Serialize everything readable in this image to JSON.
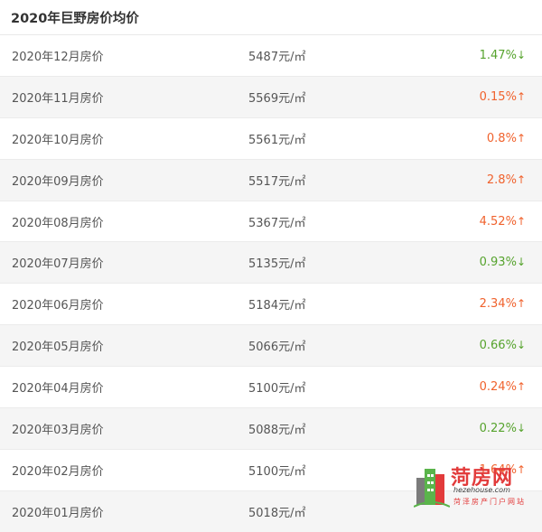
{
  "title": "2020年巨野房价均价",
  "rows": [
    {
      "month": "2020年12月房价",
      "price": "5487元/㎡",
      "change": "1.47%",
      "dir": "down"
    },
    {
      "month": "2020年11月房价",
      "price": "5569元/㎡",
      "change": "0.15%",
      "dir": "up"
    },
    {
      "month": "2020年10月房价",
      "price": "5561元/㎡",
      "change": "0.8%",
      "dir": "up"
    },
    {
      "month": "2020年09月房价",
      "price": "5517元/㎡",
      "change": "2.8%",
      "dir": "up"
    },
    {
      "month": "2020年08月房价",
      "price": "5367元/㎡",
      "change": "4.52%",
      "dir": "up"
    },
    {
      "month": "2020年07月房价",
      "price": "5135元/㎡",
      "change": "0.93%",
      "dir": "down"
    },
    {
      "month": "2020年06月房价",
      "price": "5184元/㎡",
      "change": "2.34%",
      "dir": "up"
    },
    {
      "month": "2020年05月房价",
      "price": "5066元/㎡",
      "change": "0.66%",
      "dir": "down"
    },
    {
      "month": "2020年04月房价",
      "price": "5100元/㎡",
      "change": "0.24%",
      "dir": "up"
    },
    {
      "month": "2020年03月房价",
      "price": "5088元/㎡",
      "change": "0.22%",
      "dir": "down"
    },
    {
      "month": "2020年02月房价",
      "price": "5100元/㎡",
      "change": "1.64%",
      "dir": "up"
    },
    {
      "month": "2020年01月房价",
      "price": "5018元/㎡",
      "change": "",
      "dir": ""
    }
  ],
  "watermark": {
    "name": "菏房网",
    "url": "hezehouse.com",
    "subtitle": "菏泽房产门户网站"
  },
  "colors": {
    "up": "#f0622d",
    "down": "#56a32d",
    "brand": "#e23b3b"
  },
  "icons": {
    "up": "arrow-up-icon",
    "down": "arrow-down-icon",
    "logo": "building-logo-icon"
  }
}
